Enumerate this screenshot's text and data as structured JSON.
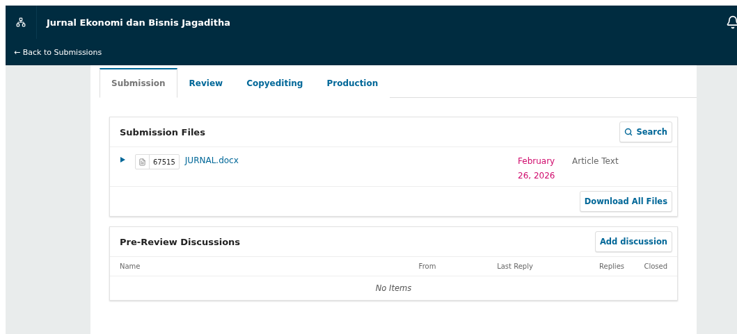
{
  "header": {
    "title": "Jurnal Ekonomi dan Bisnis Jagaditha",
    "back_link": "← Back to Submissions"
  },
  "tabs": [
    {
      "label": "Submission",
      "selected": true
    },
    {
      "label": "Review",
      "selected": false
    },
    {
      "label": "Copyediting",
      "selected": false
    },
    {
      "label": "Production",
      "selected": false
    }
  ],
  "submission_files": {
    "title": "Submission Files",
    "search_button": "Search",
    "files": [
      {
        "expanded": false,
        "id": "67515",
        "name": "JURNAL.docx",
        "date": "February 26, 2026",
        "type": "Article Text"
      }
    ],
    "download_button": "Download All Files"
  },
  "discussions": {
    "title": "Pre-Review Discussions",
    "add_button": "Add discussion",
    "columns": [
      "Name",
      "From",
      "Last Reply",
      "Replies",
      "Closed"
    ],
    "empty_text": "No Items"
  }
}
